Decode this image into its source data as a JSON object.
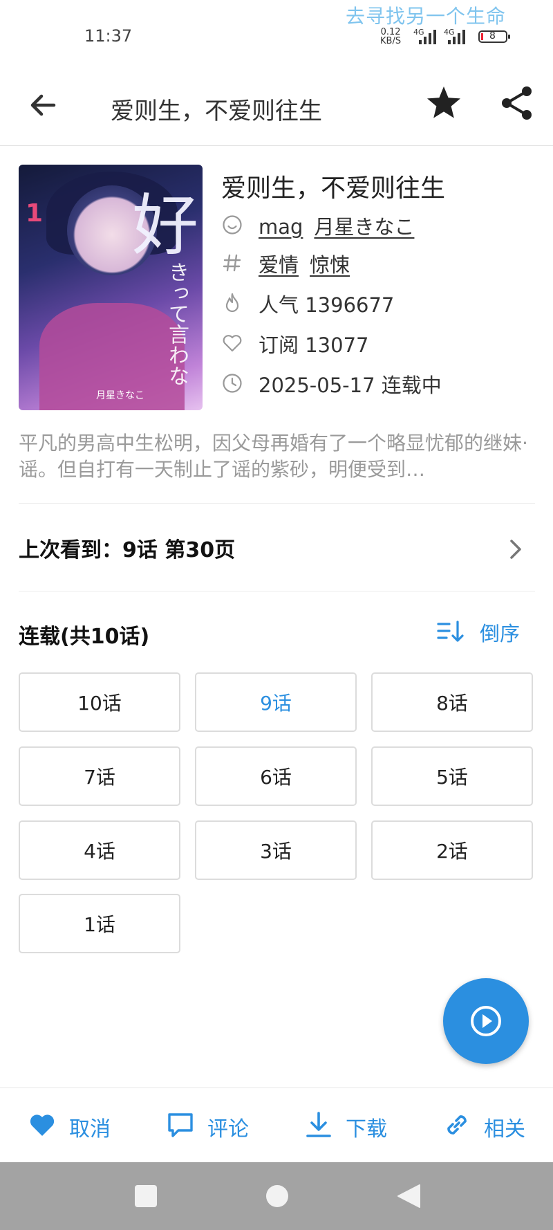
{
  "status": {
    "time": "11:37",
    "overlay_text": "去寻找另一个生命",
    "speed_value": "0.12",
    "speed_unit": "KB/S",
    "sim1_label": "4G",
    "sim2_label": "4G",
    "battery": "8"
  },
  "appbar": {
    "title": "爱则生，不爱则往生"
  },
  "comic": {
    "title": "爱则生，不爱则往生",
    "cover_title_glyph": "好",
    "cover_volume": "1",
    "cover_vertical_text": "きって言わな",
    "cover_author": "月星きなこ",
    "authors": [
      "mag",
      "月星きなこ"
    ],
    "tags": [
      "爱情",
      "惊悚"
    ],
    "popularity": "人气 1396677",
    "subscriptions": "订阅 13077",
    "update": "2025-05-17 连载中",
    "description": "平凡的男高中生松明，因父母再婚有了一个略显忧郁的继妹·谣。但自打有一天制止了谣的紫砂，明便受到…"
  },
  "last_read": {
    "label": "上次看到：9话  第30页"
  },
  "chapters": {
    "title": "连载(共10话)",
    "sort_label": "倒序",
    "items": [
      "10话",
      "9话",
      "8话",
      "7话",
      "6话",
      "5话",
      "4话",
      "3话",
      "2话",
      "1话"
    ],
    "active": "9话"
  },
  "bottom": {
    "favorite": "取消",
    "comment": "评论",
    "download": "下载",
    "related": "相关"
  },
  "colors": {
    "accent": "#2b8fe0",
    "text": "#222222",
    "muted": "#9a9a9a",
    "navbar": "#a3a3a3"
  }
}
